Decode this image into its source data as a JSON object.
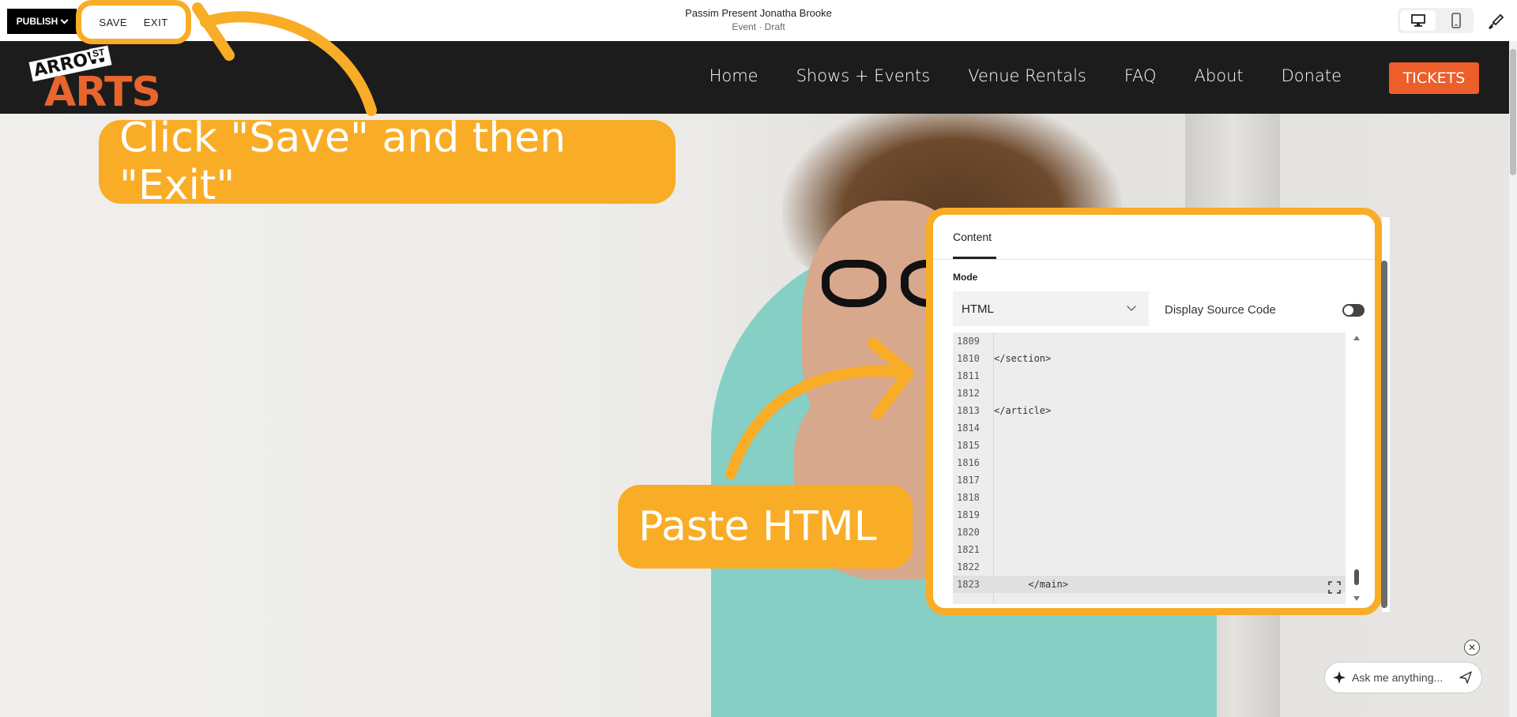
{
  "editor": {
    "publish_label": "PUBLISH",
    "save_label": "SAVE",
    "exit_label": "EXIT",
    "page_title": "Passim Present Jonatha Brooke",
    "page_status": "Event · Draft"
  },
  "site": {
    "logo_text_top": "ARROW",
    "logo_text_st": "ST",
    "logo_text_main": "ARTS",
    "nav": [
      "Home",
      "Shows + Events",
      "Venue Rentals",
      "FAQ",
      "About",
      "Donate"
    ],
    "tickets_label": "TICKETS",
    "brand_colors": {
      "header_bg": "#1c1c1c",
      "tickets": "#ed5e2b",
      "logo": "#e8652d"
    }
  },
  "callouts": {
    "save_exit": "Click \"Save\" and then \"Exit\"",
    "paste_html": "Paste HTML",
    "accent": "#f9ac26"
  },
  "panel": {
    "tab_label": "Content",
    "mode_label": "Mode",
    "mode_value": "HTML",
    "display_source_label": "Display Source Code",
    "display_source_on": false,
    "code_lines": [
      {
        "n": "1809",
        "text": ""
      },
      {
        "n": "1810",
        "text": "</section>"
      },
      {
        "n": "1811",
        "text": ""
      },
      {
        "n": "1812",
        "text": ""
      },
      {
        "n": "1813",
        "text": "</article>"
      },
      {
        "n": "1814",
        "text": ""
      },
      {
        "n": "1815",
        "text": ""
      },
      {
        "n": "1816",
        "text": ""
      },
      {
        "n": "1817",
        "text": ""
      },
      {
        "n": "1818",
        "text": ""
      },
      {
        "n": "1819",
        "text": ""
      },
      {
        "n": "1820",
        "text": ""
      },
      {
        "n": "1821",
        "text": ""
      },
      {
        "n": "1822",
        "text": ""
      },
      {
        "n": "1823",
        "text": "      </main>"
      }
    ]
  },
  "assistant": {
    "placeholder": "Ask me anything..."
  }
}
